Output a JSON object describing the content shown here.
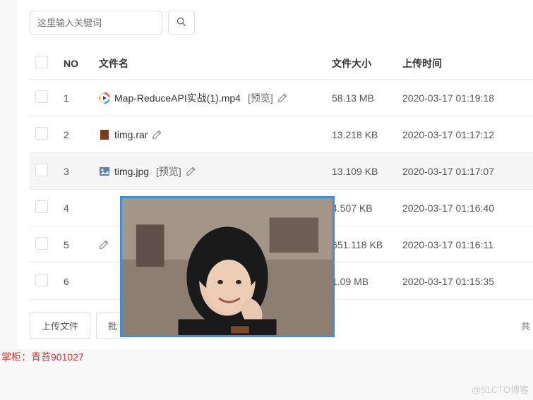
{
  "search": {
    "placeholder": "这里输入关键词"
  },
  "headers": {
    "no": "NO",
    "name": "文件名",
    "size": "文件大小",
    "time": "上传时间"
  },
  "rows": [
    {
      "no": "1",
      "name": "Map-ReduceAPI实战(1).mp4",
      "preview": "[预览]",
      "size": "58.13 MB",
      "time": "2020-03-17 01:19:18",
      "type": "mp4"
    },
    {
      "no": "2",
      "name": "timg.rar",
      "preview": "",
      "size": "13.218 KB",
      "time": "2020-03-17 01:17:12",
      "type": "rar"
    },
    {
      "no": "3",
      "name": "timg.jpg",
      "preview": "[预览]",
      "size": "13.109 KB",
      "time": "2020-03-17 01:17:07",
      "type": "jpg"
    },
    {
      "no": "4",
      "name": "",
      "preview": "",
      "size": "4.507 KB",
      "time": "2020-03-17 01:16:40",
      "type": ""
    },
    {
      "no": "5",
      "name": "",
      "preview": "",
      "size": "651.118 KB",
      "time": "2020-03-17 01:16:11",
      "type": ""
    },
    {
      "no": "6",
      "name": "",
      "preview": "",
      "size": "1.09 MB",
      "time": "2020-03-17 01:15:35",
      "type": ""
    }
  ],
  "buttons": {
    "upload": "上传文件",
    "batch": "批"
  },
  "total_prefix": "共",
  "owner": "掌柜：青苔901027",
  "watermark": "@51CTO博客"
}
